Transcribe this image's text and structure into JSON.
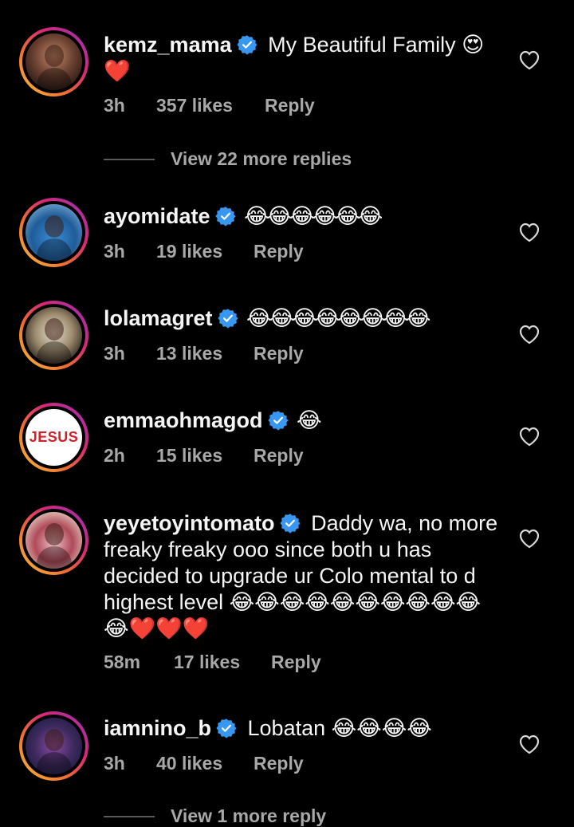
{
  "comments": [
    {
      "username": "kemz_mama",
      "text": " My Beautiful Family 😍",
      "text_line2": "❤️",
      "time": "3h",
      "likes": "357 likes",
      "reply": "Reply",
      "avatar": "woman-portrait",
      "view_more": "View 22 more replies"
    },
    {
      "username": "ayomidate",
      "text": " 😂😂😂😂😂😂",
      "time": "3h",
      "likes": "19 likes",
      "reply": "Reply",
      "avatar": "man-blue-outfit"
    },
    {
      "username": "lolamagret",
      "text": " 😂😂😂😂😂😂😂😂",
      "time": "3h",
      "likes": "13 likes",
      "reply": "Reply",
      "avatar": "woman-dark-outfit"
    },
    {
      "username": "emmaohmagod",
      "text": " 😂",
      "time": "2h",
      "likes": "15 likes",
      "reply": "Reply",
      "avatar_text": "JESUS"
    },
    {
      "username": "yeyetoyintomato",
      "text": " Daddy wa, no more freaky freaky ooo since both u has decided to upgrade ur Colo mental to d highest level 😂😂😂😂😂😂😂😂😂😂😂❤️❤️❤️",
      "time": "58m",
      "likes": "17 likes",
      "reply": "Reply",
      "avatar": "woman-red-outfit"
    },
    {
      "username": "iamnino_b",
      "text": " Lobatan 😂😂😂😂",
      "time": "3h",
      "likes": "40 likes",
      "reply": "Reply",
      "avatar": "man-purple-agbada",
      "view_more": "View 1 more reply"
    }
  ],
  "colors": {
    "background": "#000000",
    "text": "#f5f5f5",
    "meta": "#a8a8a8",
    "verified": "#3897f0",
    "story_ring_start": "#f9c23c",
    "story_ring_end": "#962fbf"
  },
  "icons": {
    "verified": "verified-badge-icon",
    "like": "heart-outline-icon"
  }
}
